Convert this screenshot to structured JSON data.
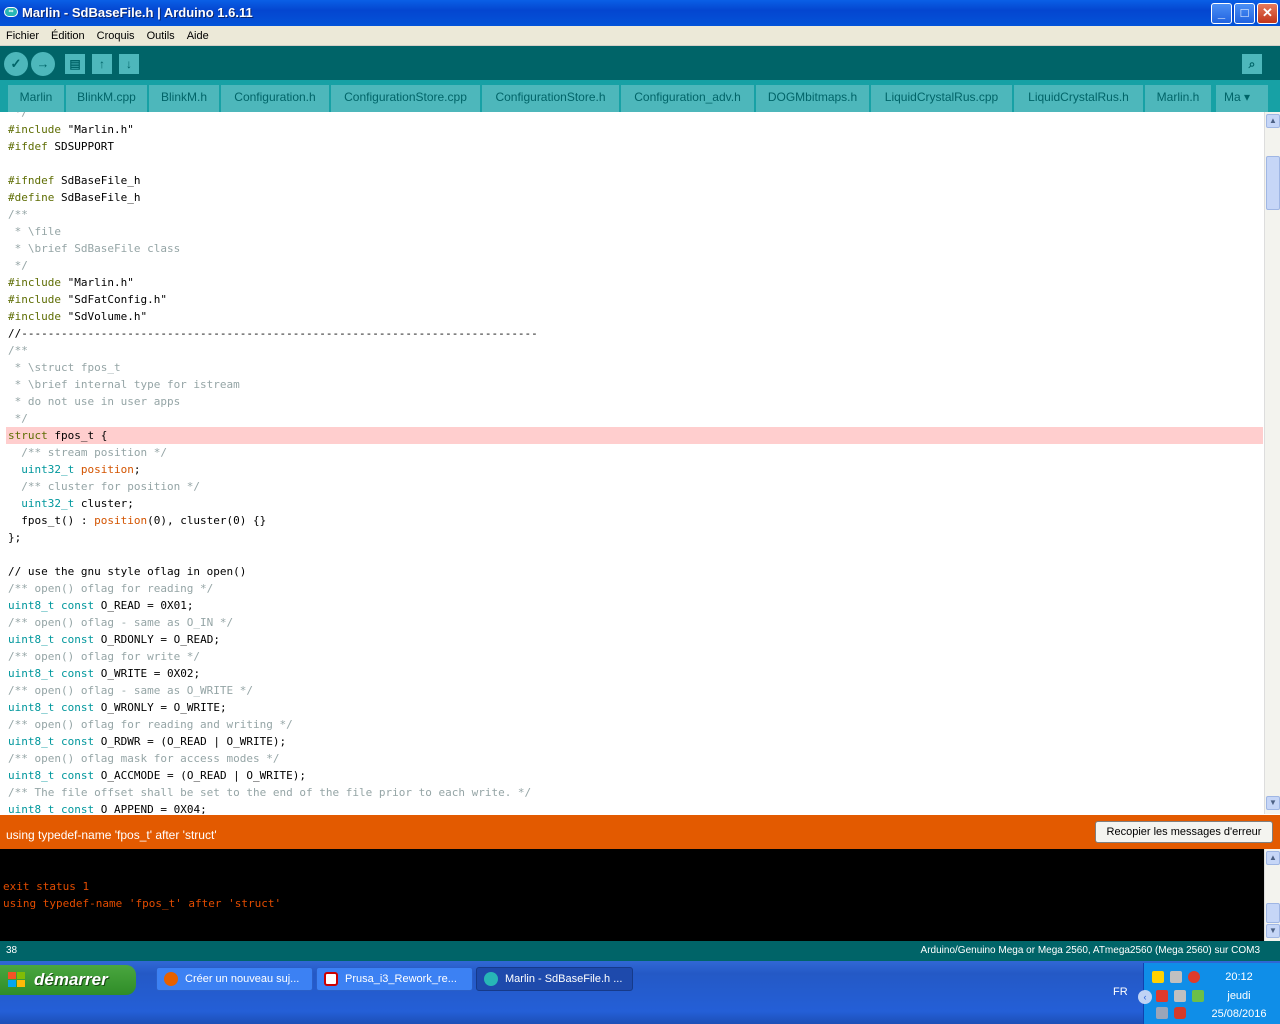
{
  "window": {
    "title": "Marlin - SdBaseFile.h | Arduino 1.6.11",
    "buttons": {
      "minimize": "_",
      "maximize": "□",
      "close": "✕"
    }
  },
  "menu": [
    "Fichier",
    "Édition",
    "Croquis",
    "Outils",
    "Aide"
  ],
  "toolbar": {
    "verify": "✓",
    "upload": "→",
    "new": "▤",
    "open": "↑",
    "save": "↓",
    "serial": "⌕"
  },
  "tabs": [
    "Marlin",
    "BlinkM.cpp",
    "BlinkM.h",
    "Configuration.h",
    "ConfigurationStore.cpp",
    "ConfigurationStore.h",
    "Configuration_adv.h",
    "DOGMbitmaps.h",
    "LiquidCrystalRus.cpp",
    "LiquidCrystalRus.h",
    "Marlin.h"
  ],
  "tab_more": "Ma ▾",
  "colors": {
    "teal_dark": "#006468",
    "teal_mid": "#17a1a5",
    "teal_light": "#4db7bb",
    "error_orange": "#e35a00",
    "highlight": "#ffcece",
    "keyword_olive": "#5e6d03",
    "type_teal": "#00979c",
    "comment_gray": "#95a5a6",
    "literal_orange": "#d35400"
  },
  "code": [
    [
      {
        "t": " */",
        "c": "comment"
      }
    ],
    [
      {
        "t": "#include",
        "c": "kw"
      },
      {
        "t": " \"Marlin.h\"",
        "c": "plain"
      }
    ],
    [
      {
        "t": "#ifdef",
        "c": "kw"
      },
      {
        "t": " SDSUPPORT",
        "c": "plain"
      }
    ],
    [],
    [
      {
        "t": "#ifndef",
        "c": "kw"
      },
      {
        "t": " SdBaseFile_h",
        "c": "plain"
      }
    ],
    [
      {
        "t": "#define",
        "c": "kw"
      },
      {
        "t": " SdBaseFile_h",
        "c": "plain"
      }
    ],
    [
      {
        "t": "/**",
        "c": "comment"
      }
    ],
    [
      {
        "t": " * \\file",
        "c": "comment"
      }
    ],
    [
      {
        "t": " * \\brief SdBaseFile class",
        "c": "comment"
      }
    ],
    [
      {
        "t": " */",
        "c": "comment"
      }
    ],
    [
      {
        "t": "#include",
        "c": "kw"
      },
      {
        "t": " \"Marlin.h\"",
        "c": "plain"
      }
    ],
    [
      {
        "t": "#include",
        "c": "kw"
      },
      {
        "t": " \"SdFatConfig.h\"",
        "c": "plain"
      }
    ],
    [
      {
        "t": "#include",
        "c": "kw"
      },
      {
        "t": " \"SdVolume.h\"",
        "c": "plain"
      }
    ],
    [
      {
        "t": "//------------------------------------------------------------------------------",
        "c": "plain"
      }
    ],
    [
      {
        "t": "/**",
        "c": "comment"
      }
    ],
    [
      {
        "t": " * \\struct fpos_t",
        "c": "comment"
      }
    ],
    [
      {
        "t": " * \\brief internal type for istream",
        "c": "comment"
      }
    ],
    [
      {
        "t": " * do not use in user apps",
        "c": "comment"
      }
    ],
    [
      {
        "t": " */",
        "c": "comment"
      }
    ],
    [
      {
        "t": "struct",
        "c": "kw"
      },
      {
        "t": " fpos_t {",
        "c": "plain"
      }
    ],
    [
      {
        "t": "  /** stream position */",
        "c": "comment"
      }
    ],
    [
      {
        "t": "  ",
        "c": "plain"
      },
      {
        "t": "uint32_t",
        "c": "type"
      },
      {
        "t": " ",
        "c": "plain"
      },
      {
        "t": "position",
        "c": "lit"
      },
      {
        "t": ";",
        "c": "plain"
      }
    ],
    [
      {
        "t": "  /** cluster for position */",
        "c": "comment"
      }
    ],
    [
      {
        "t": "  ",
        "c": "plain"
      },
      {
        "t": "uint32_t",
        "c": "type"
      },
      {
        "t": " cluster;",
        "c": "plain"
      }
    ],
    [
      {
        "t": "  fpos_t() : ",
        "c": "plain"
      },
      {
        "t": "position",
        "c": "lit"
      },
      {
        "t": "(0), cluster(0) {}",
        "c": "plain"
      }
    ],
    [
      {
        "t": "};",
        "c": "plain"
      }
    ],
    [],
    [
      {
        "t": "// use the gnu style oflag in open()",
        "c": "plain"
      }
    ],
    [
      {
        "t": "/** open() oflag for reading */",
        "c": "comment"
      }
    ],
    [
      {
        "t": "uint8_t",
        "c": "type"
      },
      {
        "t": " ",
        "c": "plain"
      },
      {
        "t": "const",
        "c": "type"
      },
      {
        "t": " O_READ = 0X01;",
        "c": "plain"
      }
    ],
    [
      {
        "t": "/** open() oflag - same as O_IN */",
        "c": "comment"
      }
    ],
    [
      {
        "t": "uint8_t",
        "c": "type"
      },
      {
        "t": " ",
        "c": "plain"
      },
      {
        "t": "const",
        "c": "type"
      },
      {
        "t": " O_RDONLY = O_READ;",
        "c": "plain"
      }
    ],
    [
      {
        "t": "/** open() oflag for write */",
        "c": "comment"
      }
    ],
    [
      {
        "t": "uint8_t",
        "c": "type"
      },
      {
        "t": " ",
        "c": "plain"
      },
      {
        "t": "const",
        "c": "type"
      },
      {
        "t": " O_WRITE = 0X02;",
        "c": "plain"
      }
    ],
    [
      {
        "t": "/** open() oflag - same as O_WRITE */",
        "c": "comment"
      }
    ],
    [
      {
        "t": "uint8_t",
        "c": "type"
      },
      {
        "t": " ",
        "c": "plain"
      },
      {
        "t": "const",
        "c": "type"
      },
      {
        "t": " O_WRONLY = O_WRITE;",
        "c": "plain"
      }
    ],
    [
      {
        "t": "/** open() oflag for reading and writing */",
        "c": "comment"
      }
    ],
    [
      {
        "t": "uint8_t",
        "c": "type"
      },
      {
        "t": " ",
        "c": "plain"
      },
      {
        "t": "const",
        "c": "type"
      },
      {
        "t": " O_RDWR = (O_READ | O_WRITE);",
        "c": "plain"
      }
    ],
    [
      {
        "t": "/** open() oflag mask for access modes */",
        "c": "comment"
      }
    ],
    [
      {
        "t": "uint8_t",
        "c": "type"
      },
      {
        "t": " ",
        "c": "plain"
      },
      {
        "t": "const",
        "c": "type"
      },
      {
        "t": " O_ACCMODE = (O_READ | O_WRITE);",
        "c": "plain"
      }
    ],
    [
      {
        "t": "/** The file offset shall be set to the end of the file prior to each write. */",
        "c": "comment"
      }
    ],
    [
      {
        "t": "uint8_t",
        "c": "type"
      },
      {
        "t": " ",
        "c": "plain"
      },
      {
        "t": "const",
        "c": "type"
      },
      {
        "t": " O_APPEND = 0X04;",
        "c": "plain"
      }
    ]
  ],
  "highlighted_line_index": 19,
  "error": {
    "message": "using typedef-name 'fpos_t' after 'struct'",
    "copy_button": "Recopier les messages d'erreur"
  },
  "console": [
    "",
    "exit status 1",
    "using typedef-name 'fpos_t' after 'struct'"
  ],
  "status": {
    "line": "38",
    "board": "Arduino/Genuino Mega or Mega 2560, ATmega2560 (Mega 2560) sur COM3"
  },
  "taskbar": {
    "start": "démarrer",
    "tasks": [
      "Créer un nouveau suj...",
      "Prusa_i3_Rework_re...",
      "Marlin - SdBaseFile.h ..."
    ],
    "lang": "FR",
    "time": "20:12",
    "day": "jeudi",
    "date": "25/08/2016"
  }
}
